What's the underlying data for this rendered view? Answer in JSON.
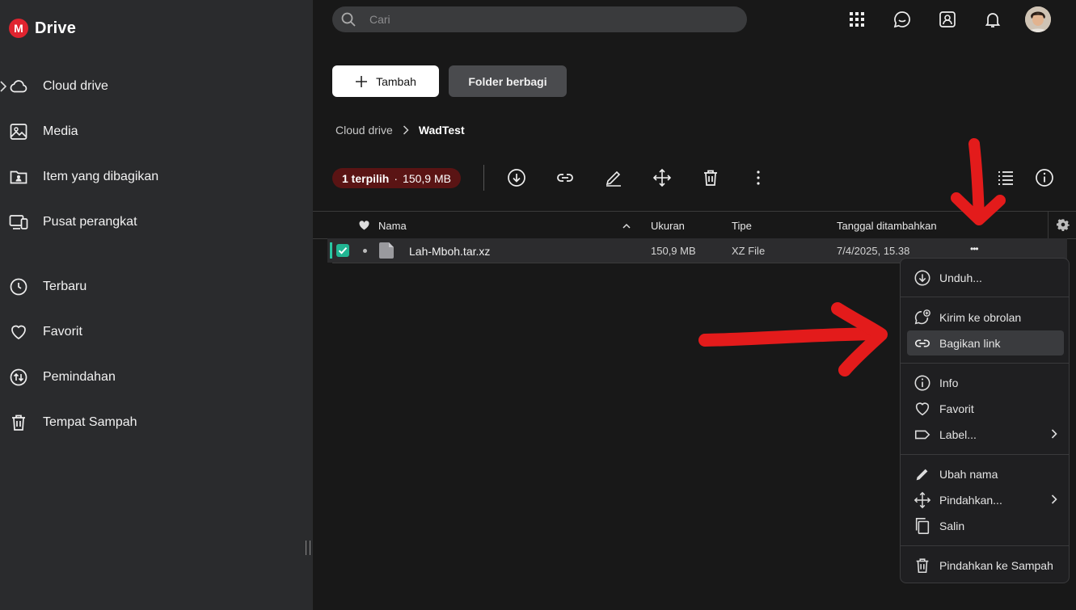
{
  "app": {
    "logo_letter": "M",
    "title": "Drive",
    "brand_color": "#e0242f"
  },
  "sidebar": {
    "items": [
      {
        "label": "Cloud drive",
        "icon": "cloud-icon"
      },
      {
        "label": "Media",
        "icon": "image-icon"
      },
      {
        "label": "Item yang dibagikan",
        "icon": "shared-folder-icon"
      },
      {
        "label": "Pusat perangkat",
        "icon": "devices-icon"
      },
      {
        "label": "Terbaru",
        "icon": "clock-icon"
      },
      {
        "label": "Favorit",
        "icon": "heart-icon"
      },
      {
        "label": "Pemindahan",
        "icon": "transfers-icon"
      },
      {
        "label": "Tempat Sampah",
        "icon": "trash-icon"
      }
    ]
  },
  "search": {
    "placeholder": "Cari"
  },
  "header": {
    "add_label": "Tambah",
    "shared_folder_label": "Folder berbagi"
  },
  "breadcrumb": {
    "root": "Cloud drive",
    "current": "WadTest"
  },
  "selection": {
    "count_label": "1 terpilih",
    "separator": "·",
    "size_label": "150,9 MB",
    "badge_color": "#5a1414"
  },
  "table": {
    "columns": {
      "name": "Nama",
      "size": "Ukuran",
      "type": "Tipe",
      "date": "Tanggal ditambahkan"
    },
    "rows": [
      {
        "name": "Lah-Mboh.tar.xz",
        "size": "150,9 MB",
        "type": "XZ File",
        "date": "7/4/2025, 15.38",
        "selected": true,
        "more": "•••"
      }
    ]
  },
  "context_menu": {
    "items": [
      {
        "label": "Unduh...",
        "icon": "download-icon"
      },
      {
        "label": "Kirim ke obrolan",
        "icon": "send-to-chat-icon"
      },
      {
        "label": "Bagikan link",
        "icon": "link-icon",
        "highlighted": true
      },
      {
        "label": "Info",
        "icon": "info-icon"
      },
      {
        "label": "Favorit",
        "icon": "heart-icon"
      },
      {
        "label": "Label...",
        "icon": "label-icon",
        "submenu": true
      },
      {
        "label": "Ubah nama",
        "icon": "rename-icon"
      },
      {
        "label": "Pindahkan...",
        "icon": "move-icon",
        "submenu": true
      },
      {
        "label": "Salin",
        "icon": "copy-icon"
      },
      {
        "label": "Pindahkan ke Sampah",
        "icon": "trash-icon"
      }
    ]
  },
  "annotations": {
    "arrow_color": "#e31b1b"
  }
}
